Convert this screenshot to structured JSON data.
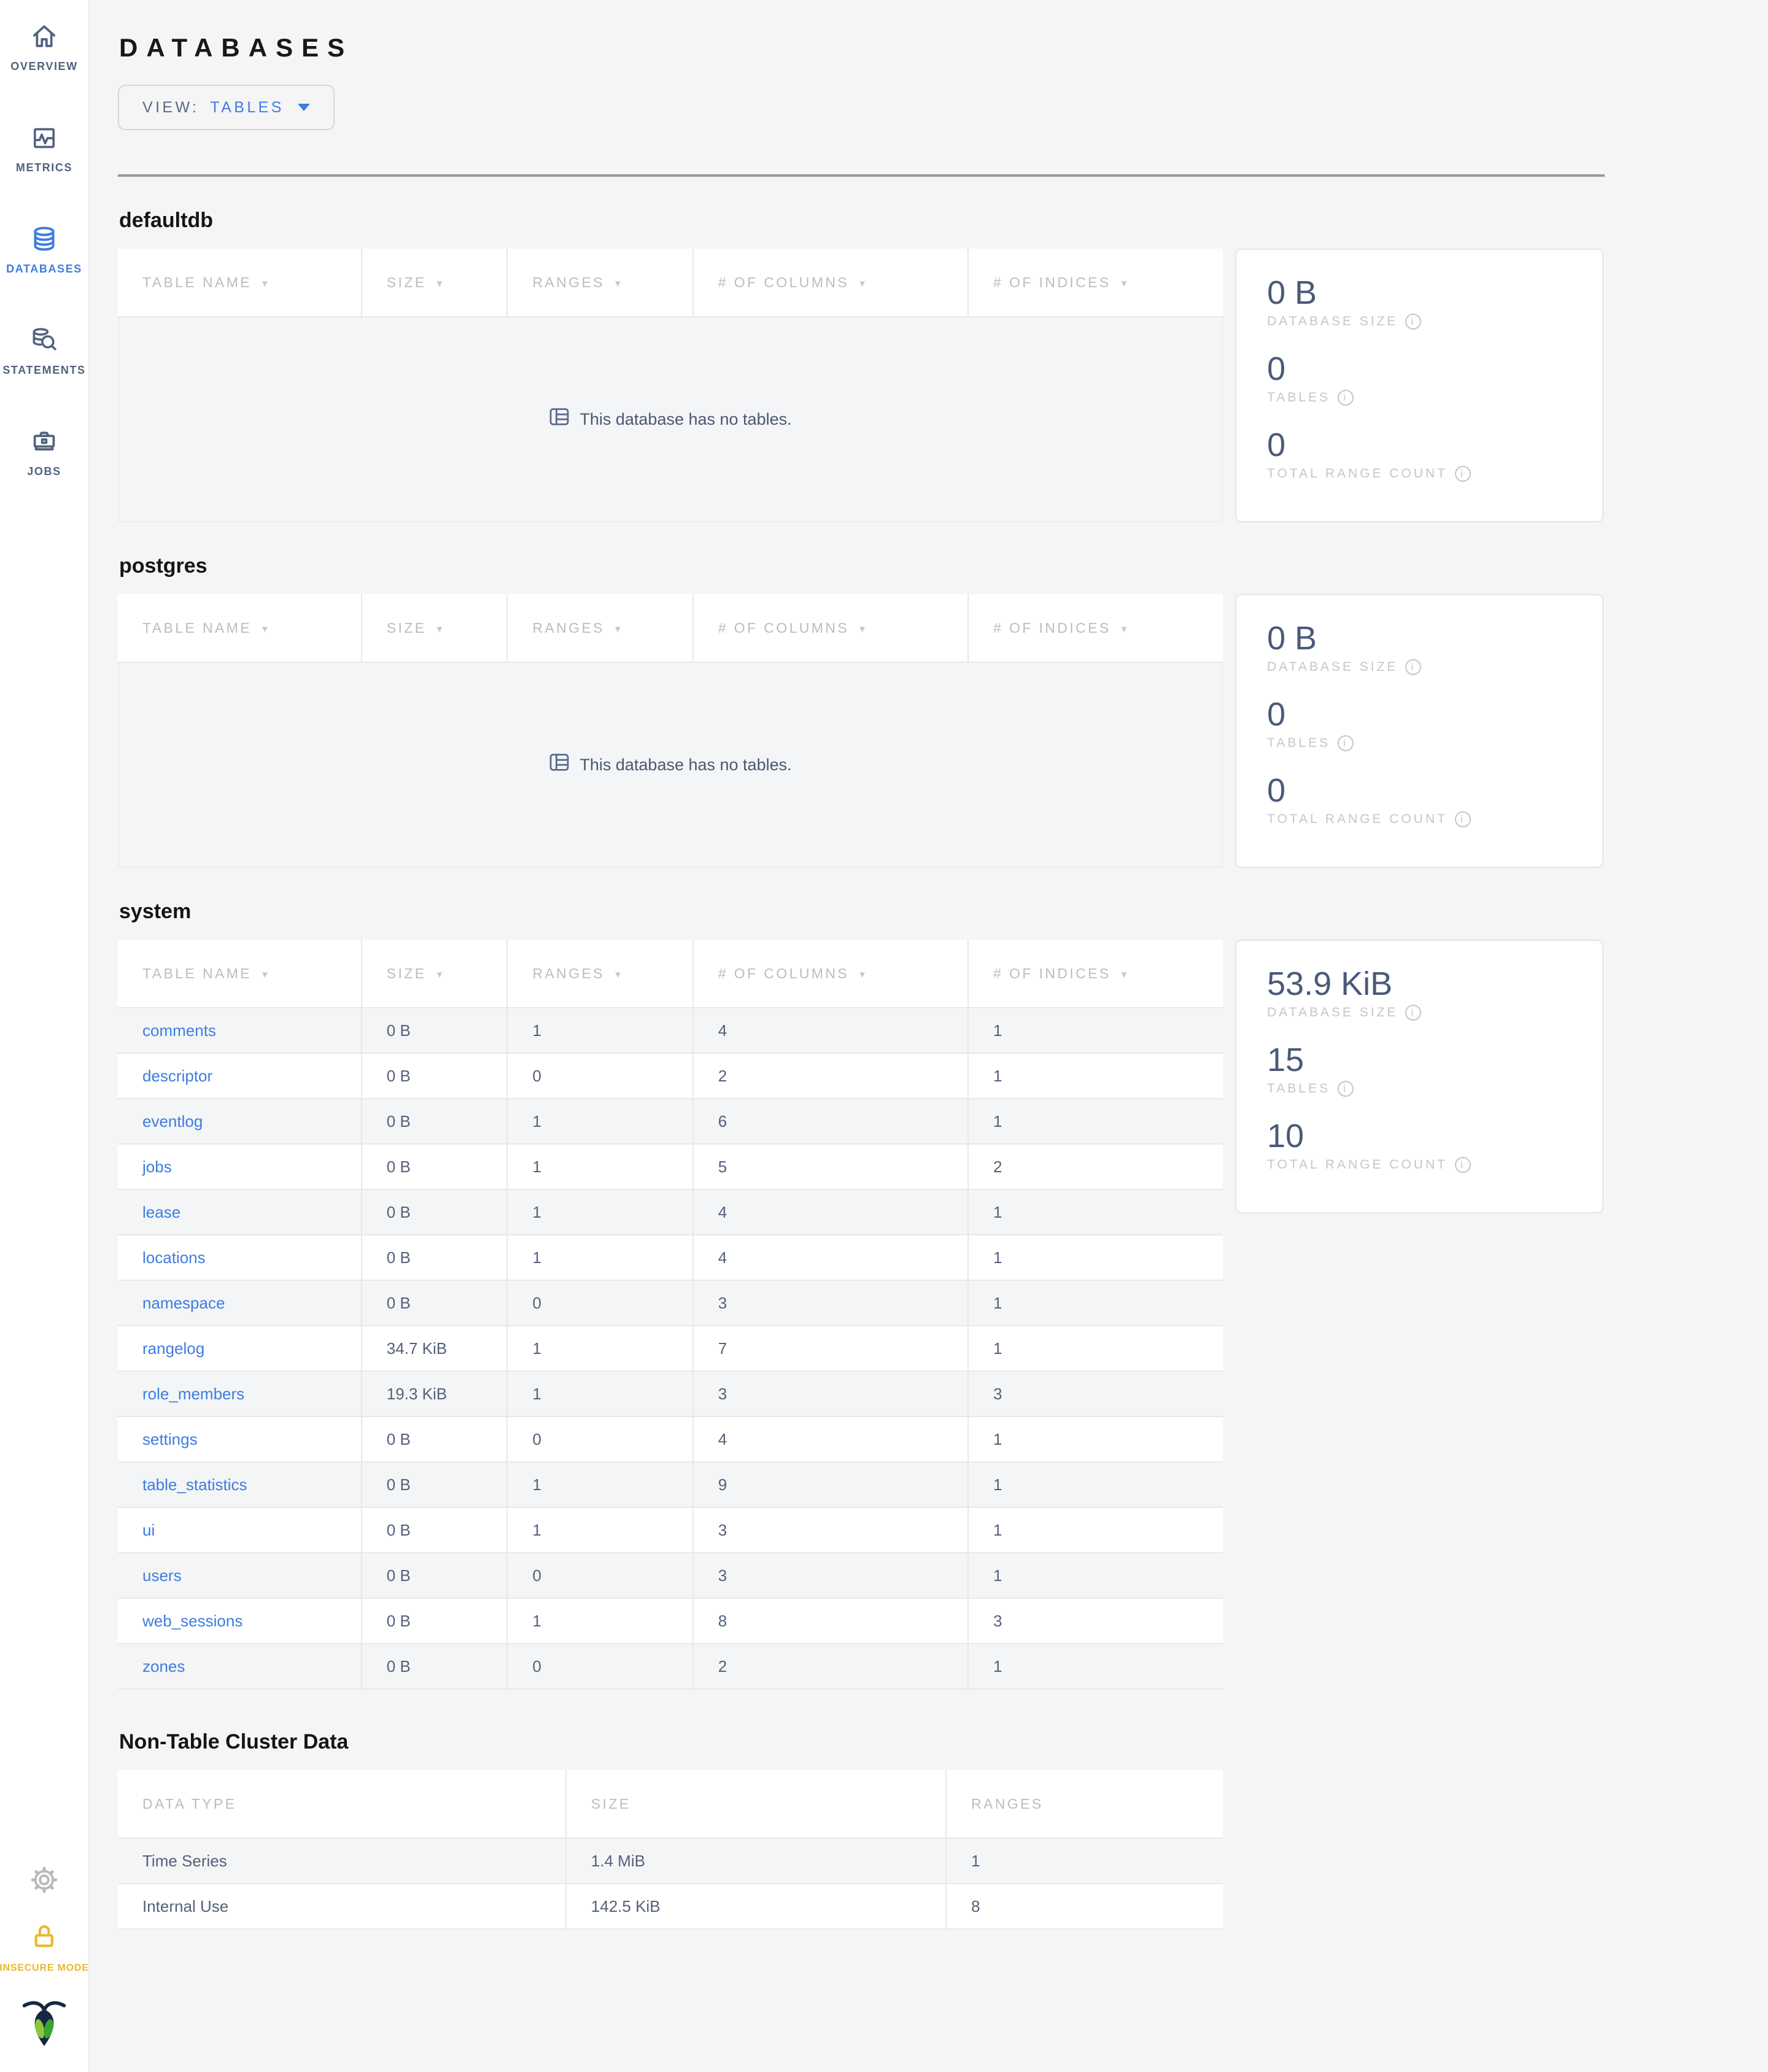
{
  "sidebar": {
    "items": [
      {
        "label": "OVERVIEW",
        "icon": "home-icon",
        "active": false
      },
      {
        "label": "METRICS",
        "icon": "metrics-icon",
        "active": false
      },
      {
        "label": "DATABASES",
        "icon": "databases-icon",
        "active": true
      },
      {
        "label": "STATEMENTS",
        "icon": "statements-icon",
        "active": false
      },
      {
        "label": "JOBS",
        "icon": "jobs-icon",
        "active": false
      }
    ],
    "insecure_mode_label": "INSECURE MODE"
  },
  "header": {
    "title": "DATABASES",
    "view_label": "VIEW:",
    "view_value": "TABLES"
  },
  "table_columns": [
    "TABLE NAME",
    "SIZE",
    "RANGES",
    "# OF COLUMNS",
    "# OF INDICES"
  ],
  "stats_labels": {
    "size": "DATABASE SIZE",
    "tables": "TABLES",
    "ranges": "TOTAL RANGE COUNT"
  },
  "empty_message": "This database has no tables.",
  "databases": [
    {
      "name": "defaultdb",
      "empty": true,
      "stats": {
        "size": "0 B",
        "tables": "0",
        "ranges": "0"
      },
      "rows": []
    },
    {
      "name": "postgres",
      "empty": true,
      "stats": {
        "size": "0 B",
        "tables": "0",
        "ranges": "0"
      },
      "rows": []
    },
    {
      "name": "system",
      "empty": false,
      "stats": {
        "size": "53.9 KiB",
        "tables": "15",
        "ranges": "10"
      },
      "rows": [
        [
          "comments",
          "0 B",
          "1",
          "4",
          "1"
        ],
        [
          "descriptor",
          "0 B",
          "0",
          "2",
          "1"
        ],
        [
          "eventlog",
          "0 B",
          "1",
          "6",
          "1"
        ],
        [
          "jobs",
          "0 B",
          "1",
          "5",
          "2"
        ],
        [
          "lease",
          "0 B",
          "1",
          "4",
          "1"
        ],
        [
          "locations",
          "0 B",
          "1",
          "4",
          "1"
        ],
        [
          "namespace",
          "0 B",
          "0",
          "3",
          "1"
        ],
        [
          "rangelog",
          "34.7 KiB",
          "1",
          "7",
          "1"
        ],
        [
          "role_members",
          "19.3 KiB",
          "1",
          "3",
          "3"
        ],
        [
          "settings",
          "0 B",
          "0",
          "4",
          "1"
        ],
        [
          "table_statistics",
          "0 B",
          "1",
          "9",
          "1"
        ],
        [
          "ui",
          "0 B",
          "1",
          "3",
          "1"
        ],
        [
          "users",
          "0 B",
          "0",
          "3",
          "1"
        ],
        [
          "web_sessions",
          "0 B",
          "1",
          "8",
          "3"
        ],
        [
          "zones",
          "0 B",
          "0",
          "2",
          "1"
        ]
      ]
    }
  ],
  "non_table": {
    "title": "Non-Table Cluster Data",
    "columns": [
      "DATA TYPE",
      "SIZE",
      "RANGES"
    ],
    "rows": [
      [
        "Time Series",
        "1.4 MiB",
        "1"
      ],
      [
        "Internal Use",
        "142.5 KiB",
        "8"
      ]
    ]
  },
  "colors": {
    "accent_blue": "#3d7de0",
    "sidebar_slate": "#52617f",
    "insecure_yellow": "#eab82e",
    "page_bg": "#f5f5f6",
    "stat_number": "#4a5a78"
  }
}
